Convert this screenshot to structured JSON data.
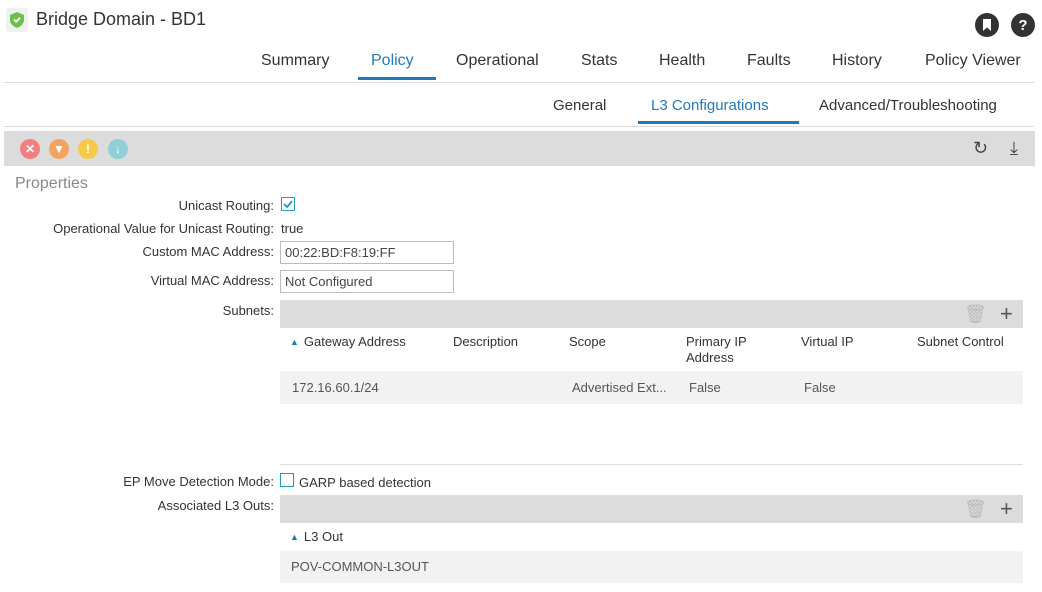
{
  "header": {
    "title": "Bridge Domain - BD1",
    "icon": "shield-icon",
    "bookmark_icon": "bookmark-icon",
    "help_label": "?"
  },
  "main_tabs": [
    {
      "label": "Summary",
      "active": false
    },
    {
      "label": "Policy",
      "active": true
    },
    {
      "label": "Operational",
      "active": false
    },
    {
      "label": "Stats",
      "active": false
    },
    {
      "label": "Health",
      "active": false
    },
    {
      "label": "Faults",
      "active": false
    },
    {
      "label": "History",
      "active": false
    },
    {
      "label": "Policy Viewer",
      "active": false
    }
  ],
  "sub_tabs": [
    {
      "label": "General",
      "active": false
    },
    {
      "label": "L3 Configurations",
      "active": true
    },
    {
      "label": "Advanced/Troubleshooting",
      "active": false
    }
  ],
  "toolbar": {
    "fault_icons": [
      {
        "name": "critical-fault-icon",
        "color": "#f08080"
      },
      {
        "name": "major-fault-icon",
        "color": "#f4a460"
      },
      {
        "name": "minor-fault-icon",
        "color": "#f7c948"
      },
      {
        "name": "warning-fault-icon",
        "color": "#8fd0d8"
      }
    ],
    "refresh_icon": "refresh-icon",
    "download_icon": "download-icon"
  },
  "properties": {
    "section_title": "Properties",
    "unicast_routing_label": "Unicast Routing:",
    "unicast_routing_checked": true,
    "operational_value_label": "Operational Value for Unicast Routing:",
    "operational_value": "true",
    "custom_mac_label": "Custom MAC Address:",
    "custom_mac_value": "00:22:BD:F8:19:FF",
    "virtual_mac_label": "Virtual MAC Address:",
    "virtual_mac_value": "Not Configured",
    "subnets_label": "Subnets:",
    "ep_move_label": "EP Move Detection Mode:",
    "ep_move_option": "GARP based detection",
    "ep_move_checked": false,
    "assoc_l3outs_label": "Associated L3 Outs:"
  },
  "subnets_table": {
    "columns": [
      "Gateway Address",
      "Description",
      "Scope",
      "Primary IP Address",
      "Virtual IP",
      "Subnet Control"
    ],
    "columns_line1": [
      "Gateway Address",
      "Description",
      "Scope",
      "Primary IP",
      "Virtual IP",
      "Subnet Control"
    ],
    "columns_line2": [
      "",
      "",
      "",
      "Address",
      "",
      ""
    ],
    "rows": [
      {
        "gateway": "172.16.60.1/24",
        "description": "",
        "scope": "Advertised Ext...",
        "primary_ip": "False",
        "virtual_ip": "False",
        "subnet_control": ""
      }
    ]
  },
  "l3outs_table": {
    "columns": [
      "L3 Out"
    ],
    "rows": [
      {
        "name": "POV-COMMON-L3OUT"
      }
    ]
  },
  "colors": {
    "accent": "#1e7ab8",
    "toolbar_bg": "#dcdcdc"
  }
}
